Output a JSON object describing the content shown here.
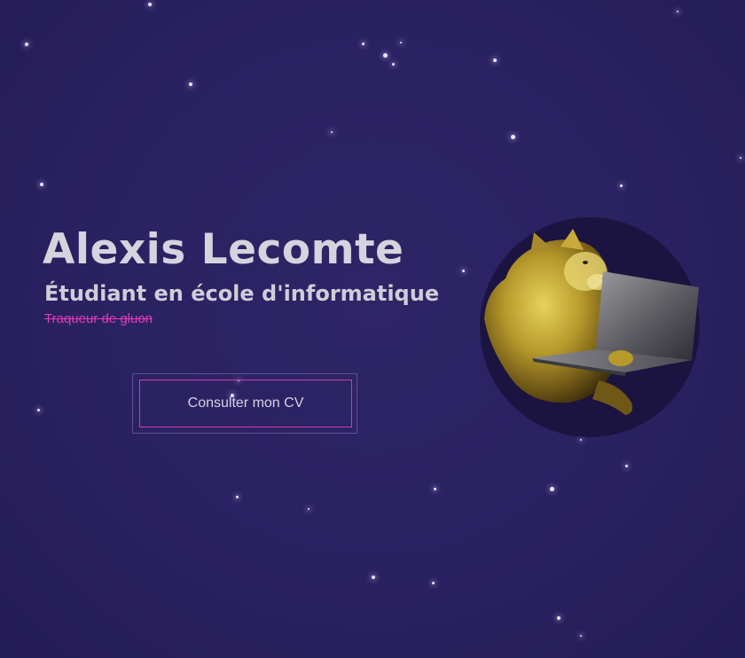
{
  "hero": {
    "name": "Alexis Lecomte",
    "subtitle": "Étudiant en école d'informatique",
    "tagline": "Traqueur de gluon"
  },
  "cta": {
    "label": "Consulter mon CV"
  },
  "avatar": {
    "icon": "doge-laptop-avatar-icon"
  },
  "colors": {
    "background": "#2a2161",
    "title_text": "#d7d3de",
    "accent_pink": "#d23ab3",
    "avatar_circle": "#1b1440"
  }
}
